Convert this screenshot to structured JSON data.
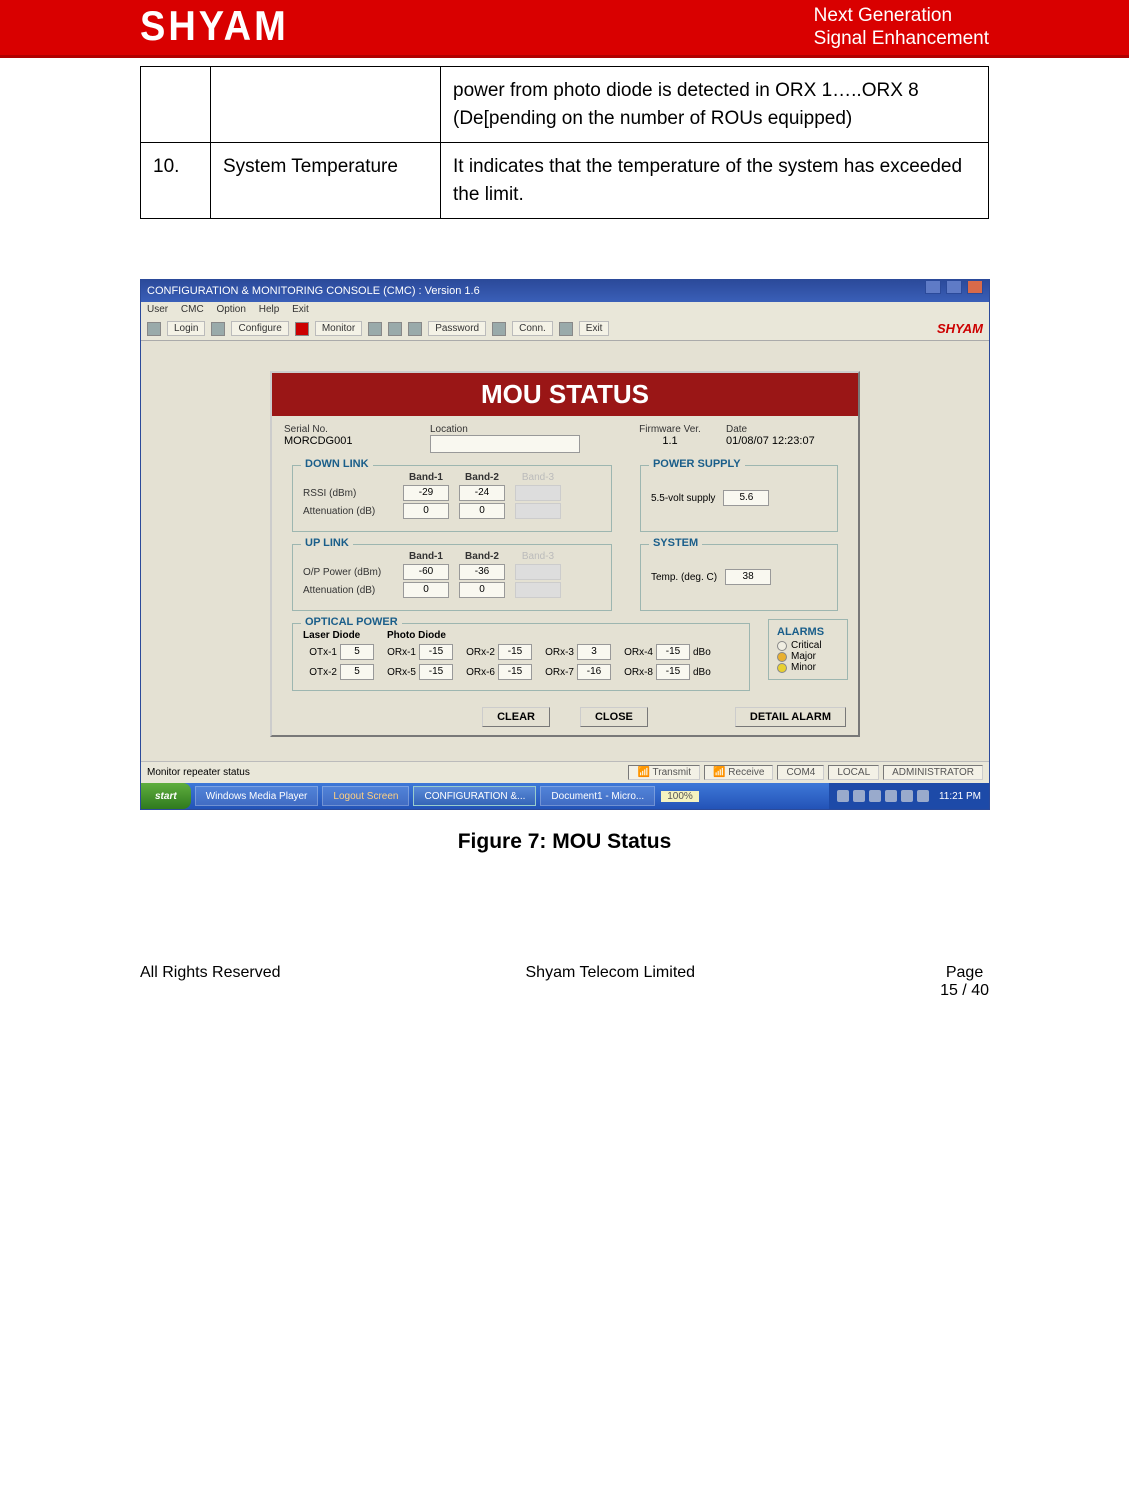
{
  "header": {
    "logo": "SHYAM",
    "tagline_line1": "Next Generation",
    "tagline_line2": "Signal Enhancement"
  },
  "alarm_table": {
    "row_prev": {
      "num": "",
      "name": "",
      "desc": "power from photo diode is detected in ORX 1…..ORX 8 (De[pending on the number of ROUs equipped)"
    },
    "row10": {
      "num": "10.",
      "name": "System Temperature",
      "desc": "It indicates that the temperature of the system has exceeded the limit."
    }
  },
  "window": {
    "title": "CONFIGURATION & MONITORING CONSOLE (CMC)  :  Version 1.6",
    "menu": {
      "m1": "User",
      "m2": "CMC",
      "m3": "Option",
      "m4": "Help",
      "m5": "Exit"
    },
    "toolbar": {
      "login": "Login",
      "configure": "Configure",
      "monitor": "Monitor",
      "password": "Password",
      "conn": "Conn.",
      "exit": "Exit",
      "brand": "SHYAM"
    },
    "mou": {
      "title": "MOU STATUS",
      "serial_lbl": "Serial No.",
      "serial_val": "MORCDG001",
      "location_lbl": "Location",
      "fw_lbl": "Firmware Ver.",
      "fw_val": "1.1",
      "date_lbl": "Date",
      "date_val": "01/08/07 12:23:07",
      "downlink": {
        "legend": "DOWN LINK",
        "b1": "Band-1",
        "b2": "Band-2",
        "b3": "Band-3",
        "rssi_lbl": "RSSI (dBm)",
        "rssi_b1": "-29",
        "rssi_b2": "-24",
        "att_lbl": "Attenuation (dB)",
        "att_b1": "0",
        "att_b2": "0"
      },
      "power": {
        "legend": "POWER SUPPLY",
        "lbl": "5.5-volt supply",
        "val": "5.6"
      },
      "uplink": {
        "legend": "UP LINK",
        "b1": "Band-1",
        "b2": "Band-2",
        "b3": "Band-3",
        "op_lbl": "O/P Power (dBm)",
        "op_b1": "-60",
        "op_b2": "-36",
        "att_lbl": "Attenuation (dB)",
        "att_b1": "0",
        "att_b2": "0"
      },
      "system": {
        "legend": "SYSTEM",
        "lbl": "Temp. (deg. C)",
        "val": "38"
      },
      "optical": {
        "legend": "OPTICAL POWER",
        "laser_lbl": "Laser Diode",
        "photo_lbl": "Photo Diode",
        "otx1_lbl": "OTx-1",
        "otx1_val": "5",
        "otx2_lbl": "OTx-2",
        "otx2_val": "5",
        "orx1_lbl": "ORx-1",
        "orx1_val": "-15",
        "orx2_lbl": "ORx-2",
        "orx2_val": "-15",
        "orx3_lbl": "ORx-3",
        "orx3_val": "3",
        "orx4_lbl": "ORx-4",
        "orx4_val": "-15",
        "orx5_lbl": "ORx-5",
        "orx5_val": "-15",
        "orx6_lbl": "ORx-6",
        "orx6_val": "-15",
        "orx7_lbl": "ORx-7",
        "orx7_val": "-16",
        "orx8_lbl": "ORx-8",
        "orx8_val": "-15",
        "unit": "dBo"
      },
      "alarms": {
        "legend": "ALARMS",
        "critical": "Critical",
        "major": "Major",
        "minor": "Minor"
      },
      "btn_clear": "CLEAR",
      "btn_close": "CLOSE",
      "btn_detail": "DETAIL ALARM"
    },
    "statusbar": {
      "left": "Monitor repeater status",
      "transmit": "Transmit",
      "receive": "Receive",
      "panel1": "COM4",
      "panel2": "LOCAL",
      "panel3": "ADMINISTRATOR"
    },
    "taskbar": {
      "start": "start",
      "t1": "Windows Media Player",
      "t2": "Logout Screen",
      "t3": "CONFIGURATION &...",
      "t4": "Document1 - Micro...",
      "badge": "100%",
      "clock": "11:21 PM"
    }
  },
  "figure_caption": "Figure 7: MOU Status",
  "footer": {
    "left": "All Rights Reserved",
    "center": "Shyam Telecom Limited",
    "right_lbl": "Page",
    "right_num": "15 / 40"
  }
}
